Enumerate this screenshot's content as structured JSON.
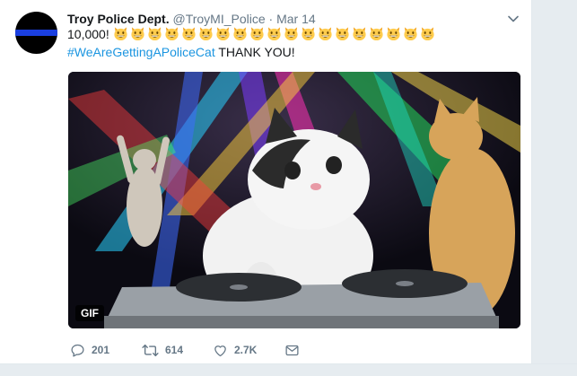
{
  "tweet": {
    "author_name": "Troy Police Dept.",
    "handle": "@TroyMI_Police",
    "separator": "·",
    "date": "Mar 14",
    "text_prefix": "10,000!",
    "emoji_count": 19,
    "emoji_icon": "grinning-cat-face-icon",
    "hashtag": "#WeAreGettingAPoliceCat",
    "text_suffix": " THANK YOU!"
  },
  "media": {
    "badge": "GIF"
  },
  "actions": {
    "replies": "201",
    "retweets": "614",
    "likes": "2.7K"
  },
  "colors": {
    "link": "#1b95e0",
    "secondary_text": "#657786",
    "avatar_stripe": "#1a3fe0",
    "page_background": "#e6ecf0"
  }
}
